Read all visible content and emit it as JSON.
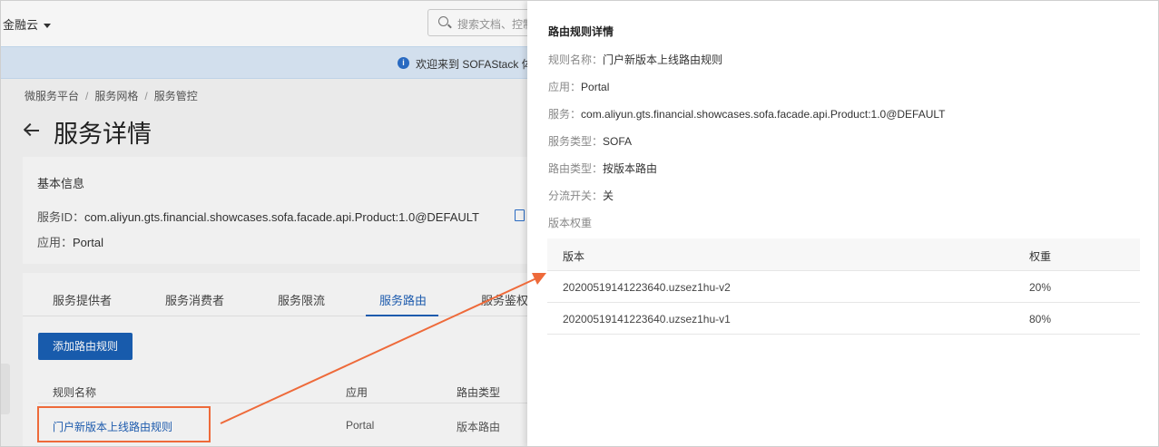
{
  "topbar": {
    "brand": "金融云",
    "search_placeholder": "搜索文档、控制"
  },
  "banner": {
    "text": "欢迎来到 SOFAStack 体"
  },
  "breadcrumb": [
    "微服务平台",
    "服务网格",
    "服务管控"
  ],
  "page": {
    "title": "服务详情"
  },
  "basic_info": {
    "heading": "基本信息",
    "service_id_label": "服务ID：",
    "service_id": "com.aliyun.gts.financial.showcases.sofa.facade.api.Product:1.0@DEFAULT",
    "app_label": "应用：",
    "app": "Portal"
  },
  "tabs": [
    "服务提供者",
    "服务消费者",
    "服务限流",
    "服务路由",
    "服务鉴权"
  ],
  "active_tab": "服务路由",
  "add_button": "添加路由规则",
  "rule_table": {
    "headers": [
      "规则名称",
      "应用",
      "路由类型"
    ],
    "rows": [
      {
        "name": "门户新版本上线路由规则",
        "app": "Portal",
        "type": "版本路由"
      }
    ]
  },
  "drawer": {
    "title": "路由规则详情",
    "fields": [
      {
        "key": "规则名称：",
        "value": "门户新版本上线路由规则"
      },
      {
        "key": "应用：",
        "value": "Portal"
      },
      {
        "key": "服务：",
        "value": "com.aliyun.gts.financial.showcases.sofa.facade.api.Product:1.0@DEFAULT"
      },
      {
        "key": "服务类型：",
        "value": "SOFA"
      },
      {
        "key": "路由类型：",
        "value": "按版本路由"
      },
      {
        "key": "分流开关：",
        "value": "关"
      }
    ],
    "weight_label": "版本权重",
    "weight_table": {
      "headers": [
        "版本",
        "权重"
      ],
      "rows": [
        {
          "version": "20200519141223640.uzsez1hu-v2",
          "weight": "20%"
        },
        {
          "version": "20200519141223640.uzsez1hu-v1",
          "weight": "80%"
        }
      ]
    }
  },
  "colors": {
    "primary": "#1a5fb4",
    "annotation": "#ee6a3a",
    "banner": "#dbe9f7"
  }
}
